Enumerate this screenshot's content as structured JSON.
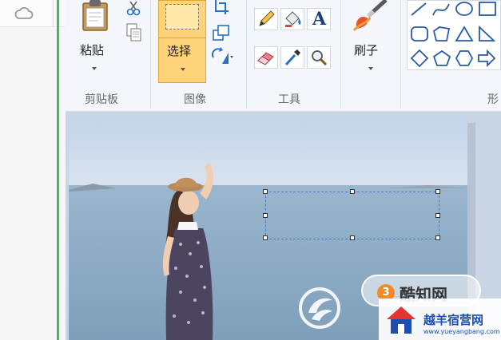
{
  "ribbon": {
    "clipboard": {
      "group_label": "剪贴板",
      "paste_label": "粘贴",
      "paste_icon": "clipboard-icon",
      "cut_icon": "scissors-icon",
      "copy_icon": "copy-icon"
    },
    "image": {
      "group_label": "图像",
      "select_label": "选择",
      "crop_icon": "crop-icon",
      "resize_icon": "resize-icon",
      "rotate_icon": "rotate-icon"
    },
    "tools": {
      "group_label": "工具",
      "items": [
        "pencil-icon",
        "fill-bucket-icon",
        "text-icon",
        "eraser-icon",
        "color-picker-icon",
        "magnifier-icon"
      ],
      "text_glyph": "A"
    },
    "brushes": {
      "label": "刷子",
      "icon": "brush-icon"
    },
    "shapes": {
      "group_label": "形",
      "items": [
        "line-icon",
        "curve-icon",
        "oval-icon",
        "rectangle-icon",
        "rounded-rectangle-icon",
        "polygon-icon",
        "triangle-icon",
        "right-triangle-icon",
        "diamond-icon",
        "pentagon-icon",
        "hexagon-icon",
        "right-arrow-icon"
      ]
    }
  },
  "canvas": {
    "watermark_badge": "酷知网",
    "watermark_coin": "3"
  },
  "site_watermark": {
    "title": "越羊宿营网",
    "url": "www.yueyangbang.com"
  },
  "colors": {
    "accent_select": "#ffd37a",
    "ribbon_bg": "#f3f6fa",
    "sea": "#8fb0c8",
    "sky": "#cad9ea",
    "green_line": "#3dbb5a"
  }
}
